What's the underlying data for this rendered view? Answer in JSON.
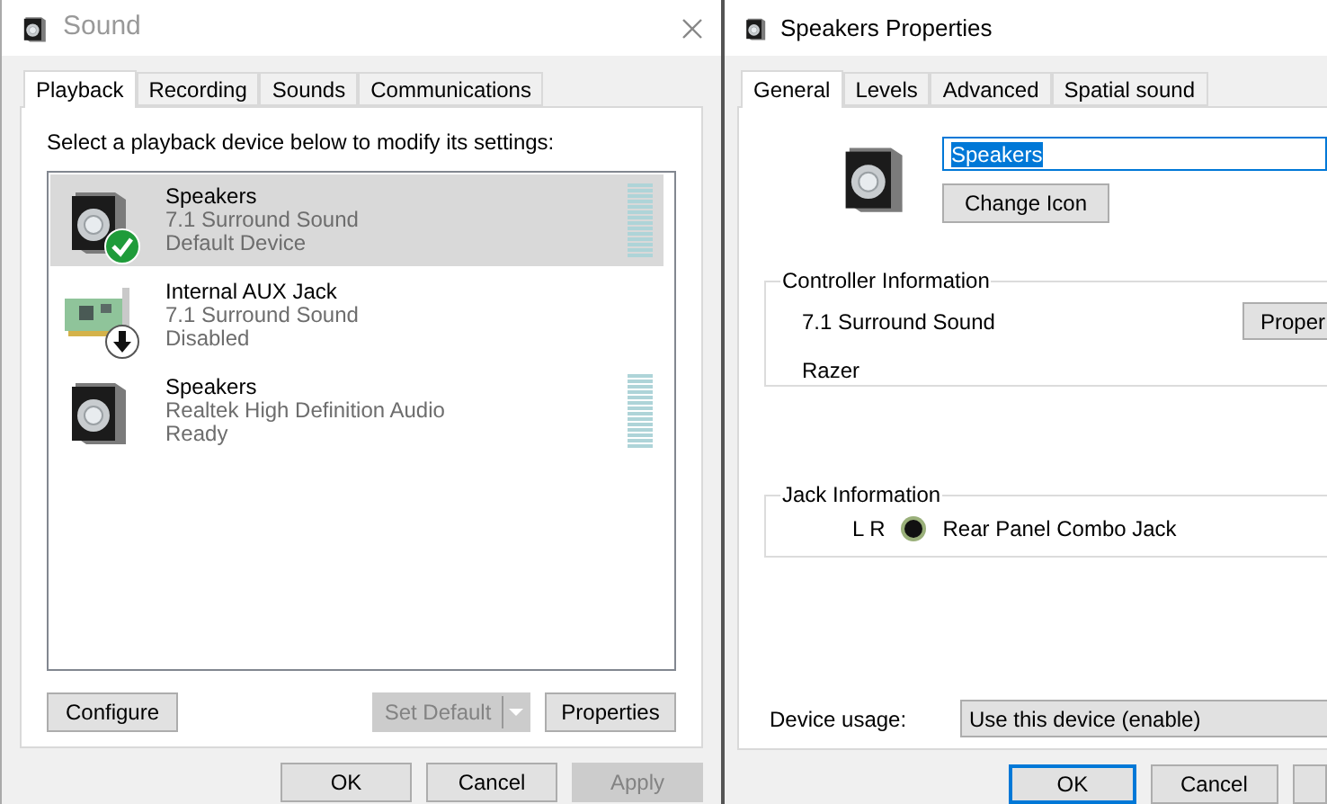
{
  "sound_window": {
    "title": "Sound",
    "active": false,
    "tabs": [
      {
        "label": "Playback",
        "selected": true
      },
      {
        "label": "Recording",
        "selected": false
      },
      {
        "label": "Sounds",
        "selected": false
      },
      {
        "label": "Communications",
        "selected": false
      }
    ],
    "instruction": "Select a playback device below to modify its settings:",
    "devices": [
      {
        "name": "Speakers",
        "description": "7.1 Surround Sound",
        "status": "Default Device",
        "kind": "speaker",
        "default": true,
        "disabled": false,
        "meter": true,
        "selected": true
      },
      {
        "name": "Internal AUX Jack",
        "description": "7.1 Surround Sound",
        "status": "Disabled",
        "kind": "card",
        "default": false,
        "disabled": true,
        "meter": false,
        "selected": false
      },
      {
        "name": "Speakers",
        "description": "Realtek High Definition Audio",
        "status": "Ready",
        "kind": "speaker",
        "default": false,
        "disabled": false,
        "meter": true,
        "selected": false
      }
    ],
    "configure_button": "Configure",
    "set_default_button": {
      "label": "Set Default",
      "disabled": true
    },
    "properties_button": "Properties",
    "footer_buttons": [
      {
        "label": "OK",
        "disabled": false
      },
      {
        "label": "Cancel",
        "disabled": false
      },
      {
        "label": "Apply",
        "disabled": true
      }
    ]
  },
  "properties_window": {
    "title": "Speakers Properties",
    "active": true,
    "tabs": [
      {
        "label": "General",
        "selected": true
      },
      {
        "label": "Levels",
        "selected": false
      },
      {
        "label": "Advanced",
        "selected": false
      },
      {
        "label": "Spatial sound",
        "selected": false
      }
    ],
    "device_name": "Speakers",
    "change_icon_button": "Change Icon",
    "controller_information": {
      "title": "Controller Information",
      "name": "7.1 Surround Sound",
      "vendor": "Razer",
      "button": "Proper"
    },
    "jack_information": {
      "title": "Jack Information",
      "channels": "L R",
      "jack": "Rear Panel Combo Jack"
    },
    "device_usage": {
      "label": "Device usage:",
      "value": "Use this device (enable)"
    },
    "footer_buttons": [
      {
        "label": "OK",
        "default": true
      },
      {
        "label": "Cancel",
        "default": false
      },
      {
        "default": false
      }
    ]
  }
}
